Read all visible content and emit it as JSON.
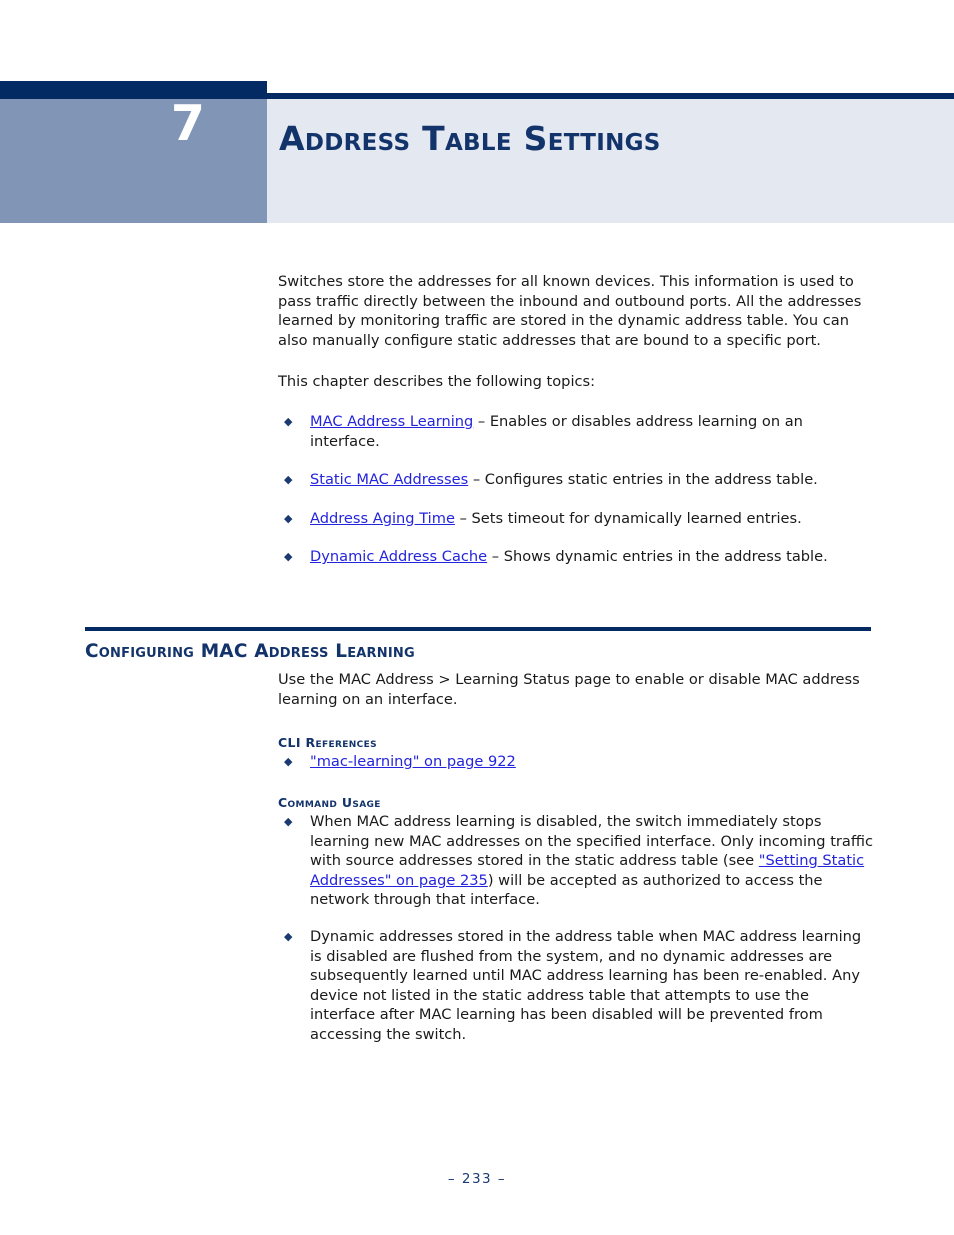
{
  "chapter": {
    "number": "7",
    "title": "Address Table Settings"
  },
  "intro": {
    "paragraph_1": "Switches store the addresses for all known devices. This information is used to pass traffic directly between the inbound and outbound ports. All the addresses learned by monitoring traffic are stored in the dynamic address table. You can also manually configure static addresses that are bound to a specific port.",
    "paragraph_2": "This chapter describes the following topics:"
  },
  "topics": [
    {
      "bullet": "◆",
      "link": "MAC Address Learning",
      "description": " – Enables or disables address learning on an interface."
    },
    {
      "bullet": "◆",
      "link": "Static MAC Addresses",
      "description": " – Configures static entries in the address table."
    },
    {
      "bullet": "◆",
      "link": "Address Aging Time",
      "description": " – Sets timeout for dynamically learned entries."
    },
    {
      "bullet": "◆",
      "link": "Dynamic Address Cache",
      "description": " – Shows dynamic entries in the address table."
    }
  ],
  "section": {
    "heading": "Configuring MAC Address Learning",
    "intro": "Use the MAC Address > Learning Status page to enable or disable MAC address learning on an interface.",
    "cli_references": {
      "heading": "CLI References",
      "items": [
        {
          "bullet": "◆",
          "link": "\"mac-learning\" on page 922"
        }
      ]
    },
    "command_usage": {
      "heading": "Command Usage",
      "items": [
        {
          "bullet": "◆",
          "text_before": "When MAC address learning is disabled, the switch immediately stops learning new MAC addresses on the specified interface. Only incoming traffic with source addresses stored in the static address table (see ",
          "link": "\"Setting Static Addresses\" on page 235",
          "text_after": ") will be accepted as authorized to access the network through that interface."
        },
        {
          "bullet": "◆",
          "text_before": "Dynamic addresses stored in the address table when MAC address learning is disabled are flushed from the system, and no dynamic addresses are subsequently learned until MAC address learning has been re-enabled. Any device not listed in the static address table that attempts to use the interface after MAC learning has been disabled will be prevented from accessing the switch.",
          "link": "",
          "text_after": ""
        }
      ]
    }
  },
  "footer": {
    "page_marker": "–  233  –"
  },
  "colors": {
    "navy": "#032a62",
    "heading_navy": "#13336b",
    "chapter_block": "#8195b7",
    "title_background": "#e4e8f1",
    "link_blue": "#2424dd",
    "bullet_navy": "#1b3a72"
  }
}
